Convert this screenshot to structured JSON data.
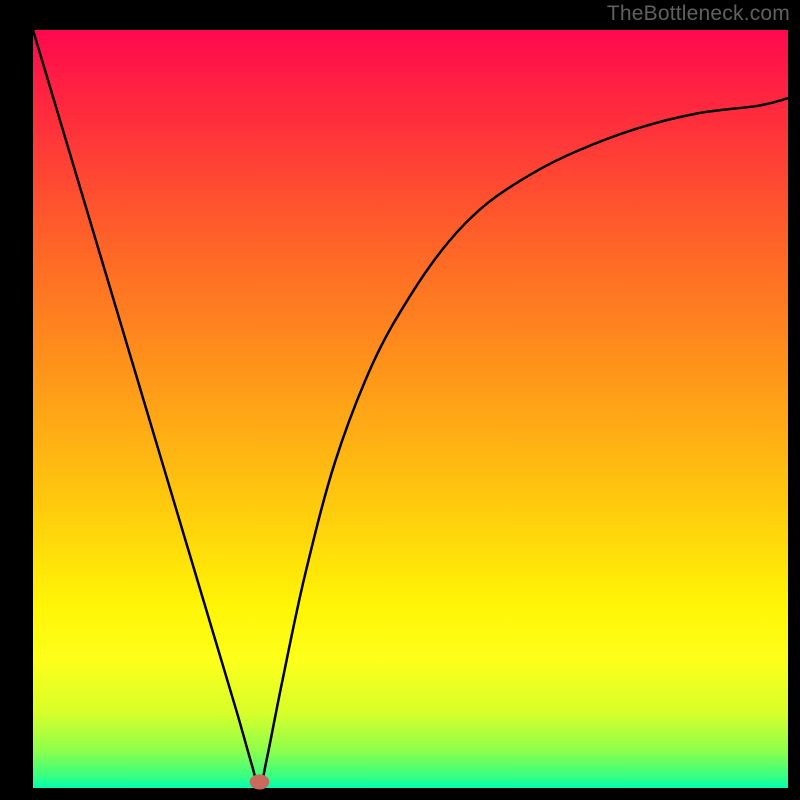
{
  "watermark": "TheBottleneck.com",
  "chart_data": {
    "type": "line",
    "title": "",
    "xlabel": "",
    "ylabel": "",
    "xlim": [
      0,
      100
    ],
    "ylim": [
      0,
      100
    ],
    "grid": false,
    "legend": false,
    "background": {
      "type": "vertical_gradient",
      "stops": [
        {
          "pos": 0.0,
          "color": "#ff094e"
        },
        {
          "pos": 0.12,
          "color": "#ff2f3c"
        },
        {
          "pos": 0.28,
          "color": "#ff6328"
        },
        {
          "pos": 0.45,
          "color": "#ff951a"
        },
        {
          "pos": 0.62,
          "color": "#ffc80e"
        },
        {
          "pos": 0.76,
          "color": "#fff506"
        },
        {
          "pos": 0.83,
          "color": "#feff1a"
        },
        {
          "pos": 0.9,
          "color": "#d8ff2a"
        },
        {
          "pos": 0.95,
          "color": "#8fff4b"
        },
        {
          "pos": 0.985,
          "color": "#36ff84"
        },
        {
          "pos": 1.0,
          "color": "#00ffb0"
        }
      ]
    },
    "series": [
      {
        "name": "bottleneck-curve",
        "color": "#000000",
        "x": [
          0,
          3,
          6,
          9,
          12,
          15,
          18,
          21,
          24,
          27,
          29,
          30,
          31,
          33,
          36,
          40,
          45,
          50,
          55,
          60,
          66,
          72,
          80,
          88,
          96,
          100
        ],
        "y": [
          100,
          90,
          80,
          70,
          60,
          50,
          40,
          30,
          20,
          10,
          3,
          0,
          4,
          14,
          28,
          43,
          56,
          65,
          72,
          77,
          81,
          84,
          87,
          89,
          90,
          91
        ]
      }
    ],
    "marker": {
      "name": "optimum-point",
      "x": 30,
      "y": 0.8,
      "color": "#c96a5d",
      "rx": 1.3,
      "ry": 1.0
    }
  }
}
